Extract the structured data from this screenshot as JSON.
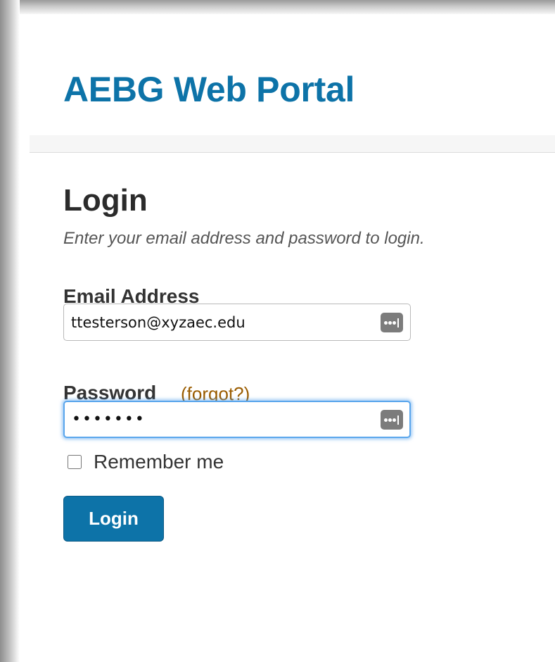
{
  "header": {
    "title": "AEBG Web Portal"
  },
  "login_form": {
    "heading": "Login",
    "hint": "Enter your email address and password to login.",
    "email": {
      "label": "Email Address",
      "value": "ttesterson@xyzaec.edu",
      "autofill_icon": "password-manager-key-icon"
    },
    "password": {
      "label": "Password",
      "forgot_link": "(forgot?)",
      "value": "•••••••",
      "focused": true,
      "autofill_icon": "password-manager-key-icon"
    },
    "remember_me": {
      "label": "Remember me",
      "checked": false
    },
    "submit_label": "Login"
  },
  "colors": {
    "brand_blue": "#0d73a8",
    "link_brown": "#9a5c00",
    "focus_ring": "#5aa6ec"
  }
}
